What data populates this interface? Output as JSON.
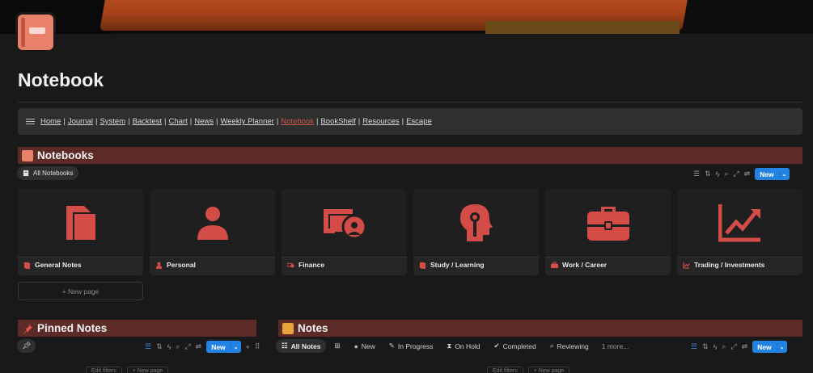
{
  "page": {
    "title": "Notebook"
  },
  "nav": {
    "items": [
      {
        "label": "Home"
      },
      {
        "label": "Journal"
      },
      {
        "label": "System"
      },
      {
        "label": "Backtest"
      },
      {
        "label": "Chart"
      },
      {
        "label": "News"
      },
      {
        "label": "Weekly Planner"
      },
      {
        "label": "Notebook",
        "active": true
      },
      {
        "label": "BookShelf"
      },
      {
        "label": "Resources"
      },
      {
        "label": "Escape"
      }
    ],
    "separator": "|"
  },
  "notebooks": {
    "heading": "Notebooks",
    "view_tab": "All Notebooks",
    "new_label": "New",
    "new_page_label": "+ New page",
    "cards": [
      {
        "title": "General Notes",
        "icon": "notes-icon"
      },
      {
        "title": "Personal",
        "icon": "person-icon"
      },
      {
        "title": "Finance",
        "icon": "money-icon"
      },
      {
        "title": "Study / Learning",
        "icon": "head-icon"
      },
      {
        "title": "Work / Career",
        "icon": "briefcase-icon"
      },
      {
        "title": "Trading / Investments",
        "icon": "chart-icon"
      }
    ]
  },
  "pinned": {
    "heading": "Pinned Notes",
    "new_label": "New"
  },
  "notes": {
    "heading": "Notes",
    "new_label": "New",
    "tabs": [
      {
        "label": "All Notes",
        "active": true
      },
      {
        "label": "New"
      },
      {
        "label": "In Progress"
      },
      {
        "label": "On Hold"
      },
      {
        "label": "Completed"
      },
      {
        "label": "Reviewing"
      }
    ],
    "more_label": "1 more...",
    "footer": {
      "edit_filters": "Edit filters",
      "new_page": "+ New page"
    }
  },
  "pinned_footer": {
    "edit_filters": "Edit filters",
    "new_page": "+ New page"
  },
  "colors": {
    "accent": "#2383e2",
    "icon_red": "#d44c47",
    "header_bg": "#5c2b27"
  }
}
